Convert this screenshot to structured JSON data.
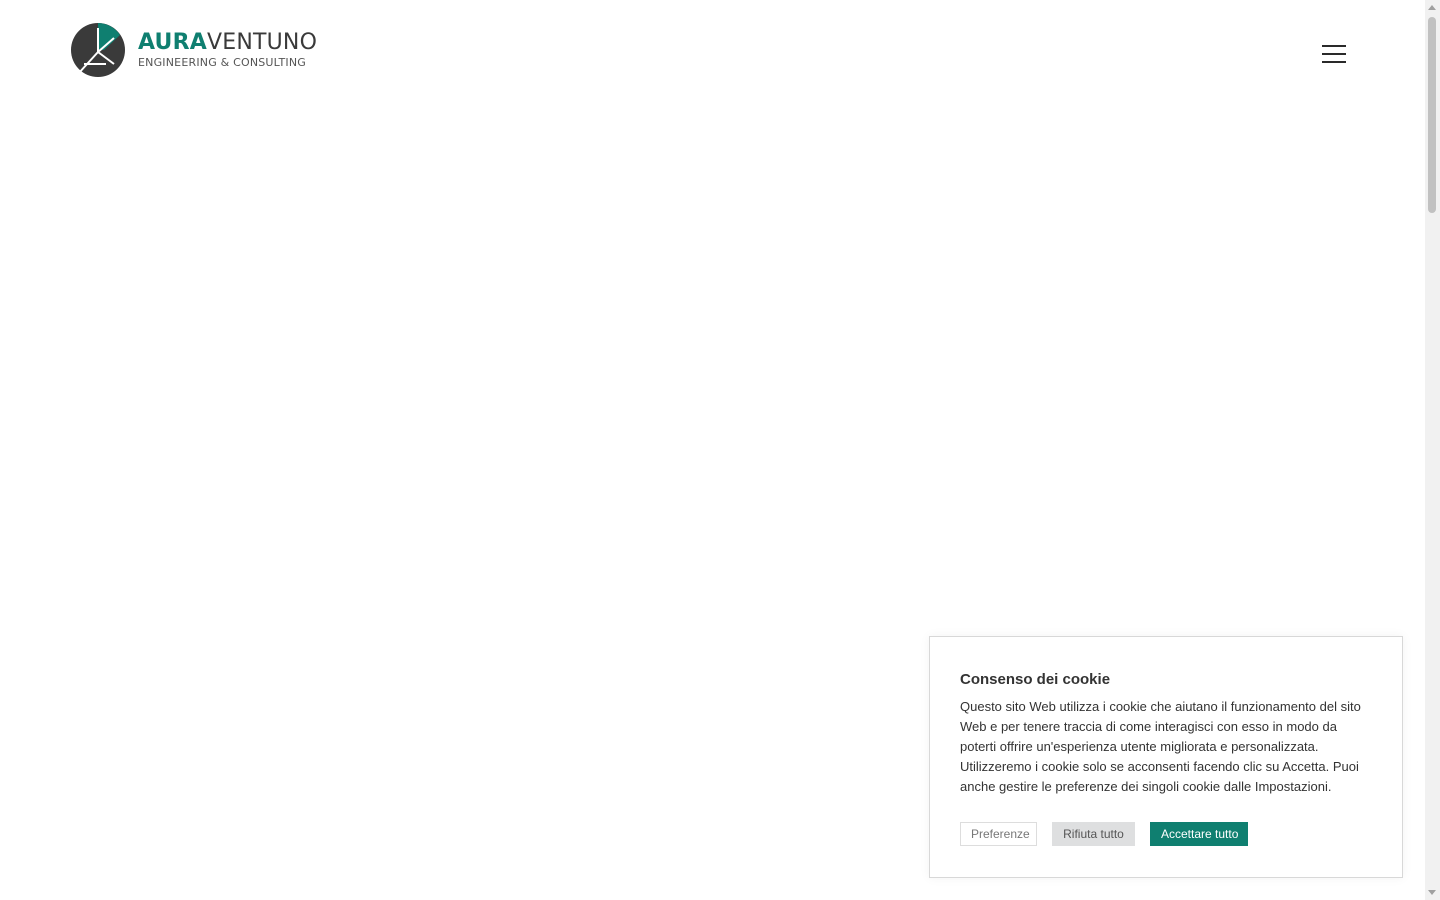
{
  "header": {
    "logo": {
      "word_part_1": "AURA",
      "word_part_2": "VENTUNO",
      "tagline": "ENGINEERING & CONSULTING"
    },
    "menu_icon": "hamburger-menu-icon"
  },
  "cookie_banner": {
    "title": "Consenso dei cookie",
    "body": "Questo sito Web utilizza i cookie che aiutano il funzionamento del sito Web e per tenere traccia di come interagisci con esso in modo da poterti offrire un'esperienza utente migliorata e personalizzata. Utilizzeremo i cookie solo se acconsenti facendo clic su Accetta. Puoi anche gestire le preferenze dei singoli cookie dalle Impostazioni.",
    "buttons": {
      "preferences": "Preferenze",
      "reject_all": "Rifiuta tutto",
      "accept_all": "Accettare tutto"
    }
  },
  "colors": {
    "brand_teal": "#0f7f70",
    "logo_dark": "#3a3a3a",
    "text": "#333333",
    "reject_bg": "#dedfe0"
  }
}
